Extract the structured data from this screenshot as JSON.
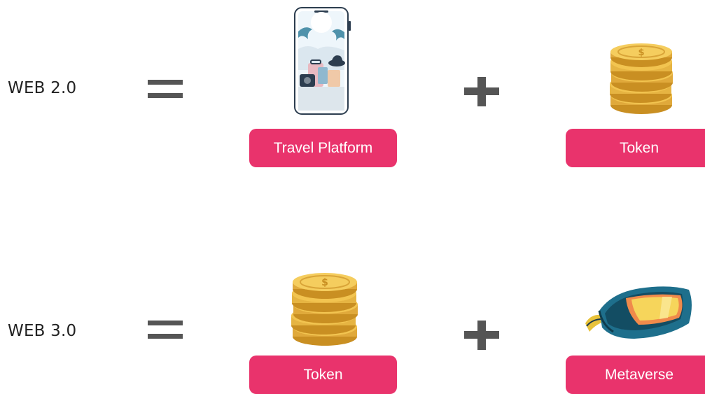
{
  "rows": [
    {
      "label": "WEB 2.0",
      "operator_equals": "equals",
      "operator_plus": "plus",
      "item_a": {
        "label": "Travel Platform",
        "icon": "smartphone-travel-icon"
      },
      "item_b": {
        "label": "Token",
        "icon": "coin-stack-icon"
      }
    },
    {
      "label": "WEB 3.0",
      "operator_equals": "equals",
      "operator_plus": "plus",
      "item_a": {
        "label": "Token",
        "icon": "coin-stack-icon"
      },
      "item_b": {
        "label": "Metaverse",
        "icon": "vr-headset-icon"
      }
    }
  ],
  "colors": {
    "pill": "#e9336c",
    "operator": "#555555",
    "coin": "#f2c450",
    "coin_shadow": "#c98f22"
  }
}
